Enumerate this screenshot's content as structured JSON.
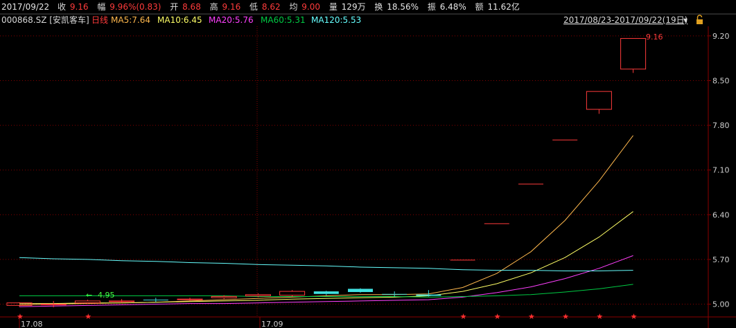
{
  "quote_bar": {
    "date": "2017/09/22",
    "close_label": "收",
    "close": "9.16",
    "change_label": "幅",
    "change": "9.96%(0.83)",
    "open_label": "开",
    "open": "8.68",
    "high_label": "高",
    "high": "9.16",
    "low_label": "低",
    "low": "8.62",
    "avg_label": "均",
    "avg": "9.00",
    "volume_label": "量",
    "volume": "129万",
    "turnover_label": "换",
    "turnover": "18.56%",
    "amplitude_label": "振",
    "amplitude": "6.48%",
    "amount_label": "额",
    "amount": "11.62亿"
  },
  "info_line": {
    "symbol": "000868.SZ [安凯客车]",
    "period": "日线",
    "ma5": "MA5:7.64",
    "ma10": "MA10:6.45",
    "ma20": "MA20:5.76",
    "ma60": "MA60:5.31",
    "ma120": "MA120:5.53",
    "range": "2017/08/23-2017/09/22(19日)",
    "dropdown_glyph": "▾"
  },
  "colors": {
    "bg": "#000000",
    "up": "#ff3b3b",
    "down": "#40e0e0",
    "flat": "#d0d0d0",
    "ma5": "#ffb84d",
    "ma10": "#ffff66",
    "ma20": "#ff40ff",
    "ma60": "#00cc44",
    "ma120": "#66ffff",
    "grid": "#8b0000",
    "star": "#ff3030",
    "low_marker": "#44ff44"
  },
  "chart_data": {
    "type": "candlestick",
    "title": "",
    "ylim": [
      4.8,
      9.35
    ],
    "y_ticks": [
      "9.20",
      "8.50",
      "7.80",
      "7.10",
      "6.40",
      "5.70",
      "5.00"
    ],
    "x_labels": [
      "17.08",
      "17.09"
    ],
    "annotations": {
      "high_label": "9.16",
      "low_label": "4.95"
    },
    "candles": [
      {
        "open": 4.98,
        "close": 5.02,
        "high": 5.03,
        "low": 4.96
      },
      {
        "open": 4.99,
        "close": 5.0,
        "high": 5.05,
        "low": 4.95
      },
      {
        "open": 5.02,
        "close": 5.05,
        "high": 5.07,
        "low": 5.0
      },
      {
        "open": 5.04,
        "close": 5.05,
        "high": 5.08,
        "low": 5.02
      },
      {
        "open": 5.07,
        "close": 5.06,
        "high": 5.1,
        "low": 5.03
      },
      {
        "open": 5.07,
        "close": 5.08,
        "high": 5.1,
        "low": 5.05
      },
      {
        "open": 5.1,
        "close": 5.12,
        "high": 5.14,
        "low": 5.08
      },
      {
        "open": 5.13,
        "close": 5.15,
        "high": 5.17,
        "low": 5.11
      },
      {
        "open": 5.14,
        "close": 5.2,
        "high": 5.22,
        "low": 5.12
      },
      {
        "open": 5.2,
        "close": 5.16,
        "high": 5.21,
        "low": 5.14
      },
      {
        "open": 5.24,
        "close": 5.19,
        "high": 5.25,
        "low": 5.18
      },
      {
        "open": 5.16,
        "close": 5.15,
        "high": 5.2,
        "low": 5.12
      },
      {
        "open": 5.15,
        "close": 5.13,
        "high": 5.22,
        "low": 5.12
      },
      {
        "open": 5.69,
        "close": 5.69,
        "high": 5.69,
        "low": 5.69
      },
      {
        "open": 6.26,
        "close": 6.26,
        "high": 6.26,
        "low": 6.26
      },
      {
        "open": 6.88,
        "close": 6.88,
        "high": 6.88,
        "low": 6.88
      },
      {
        "open": 7.57,
        "close": 7.57,
        "high": 7.57,
        "low": 7.57
      },
      {
        "open": 8.05,
        "close": 8.33,
        "high": 8.33,
        "low": 7.98
      },
      {
        "open": 8.68,
        "close": 9.16,
        "high": 9.16,
        "low": 8.62
      }
    ],
    "series": [
      {
        "name": "MA5",
        "values": [
          4.99,
          5.0,
          5.01,
          5.02,
          5.03,
          5.05,
          5.07,
          5.09,
          5.11,
          5.13,
          5.15,
          5.15,
          5.16,
          5.26,
          5.48,
          5.82,
          6.31,
          6.93,
          7.64
        ]
      },
      {
        "name": "MA10",
        "values": [
          5.01,
          5.01,
          5.02,
          5.02,
          5.03,
          5.04,
          5.05,
          5.06,
          5.08,
          5.09,
          5.1,
          5.11,
          5.13,
          5.2,
          5.32,
          5.49,
          5.73,
          6.05,
          6.45
        ]
      },
      {
        "name": "MA20",
        "values": [
          4.96,
          4.97,
          4.98,
          4.99,
          5.0,
          5.01,
          5.01,
          5.02,
          5.03,
          5.04,
          5.05,
          5.06,
          5.07,
          5.11,
          5.18,
          5.27,
          5.4,
          5.56,
          5.76
        ]
      },
      {
        "name": "MA60",
        "values": [
          5.13,
          5.13,
          5.13,
          5.13,
          5.13,
          5.13,
          5.13,
          5.12,
          5.12,
          5.12,
          5.12,
          5.12,
          5.11,
          5.12,
          5.13,
          5.15,
          5.19,
          5.24,
          5.31
        ]
      },
      {
        "name": "MA120",
        "values": [
          5.73,
          5.71,
          5.7,
          5.68,
          5.67,
          5.65,
          5.64,
          5.62,
          5.61,
          5.6,
          5.58,
          5.57,
          5.56,
          5.54,
          5.53,
          5.53,
          5.52,
          5.52,
          5.53
        ]
      }
    ]
  }
}
